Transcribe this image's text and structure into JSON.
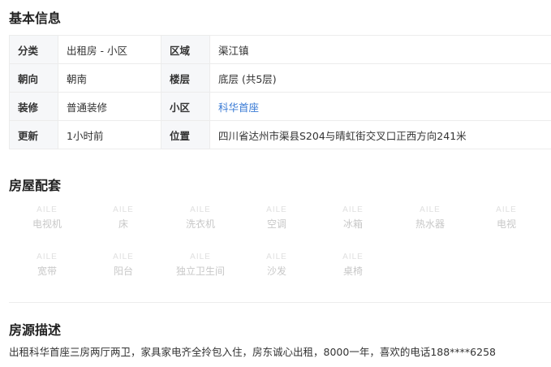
{
  "basic": {
    "title": "基本信息",
    "rows": [
      {
        "k1": "分类",
        "v1": "出租房 - 小区",
        "k2": "区域",
        "v2": "渠江镇"
      },
      {
        "k1": "朝向",
        "v1": "朝南",
        "k2": "楼层",
        "v2": "底层 (共5层)"
      },
      {
        "k1": "装修",
        "v1": "普通装修",
        "k2": "小区",
        "v2": "科华首座"
      },
      {
        "k1": "更新",
        "v1": "1小时前",
        "k2": "位置",
        "v2": "四川省达州市渠县S204与晴虹街交叉口正西方向241米"
      }
    ]
  },
  "facilities": {
    "title": "房屋配套",
    "logo_text": "AILE",
    "items": [
      "电视机",
      "床",
      "洗衣机",
      "空调",
      "冰箱",
      "热水器",
      "电视",
      "宽带",
      "阳台",
      "独立卫生间",
      "沙发",
      "桌椅"
    ]
  },
  "description": {
    "title": "房源描述",
    "text": "出租科华首座三房两厅两卫，家具家电齐全拎包入住，房东诚心出租，8000一年，喜欢的电话188****6258"
  }
}
